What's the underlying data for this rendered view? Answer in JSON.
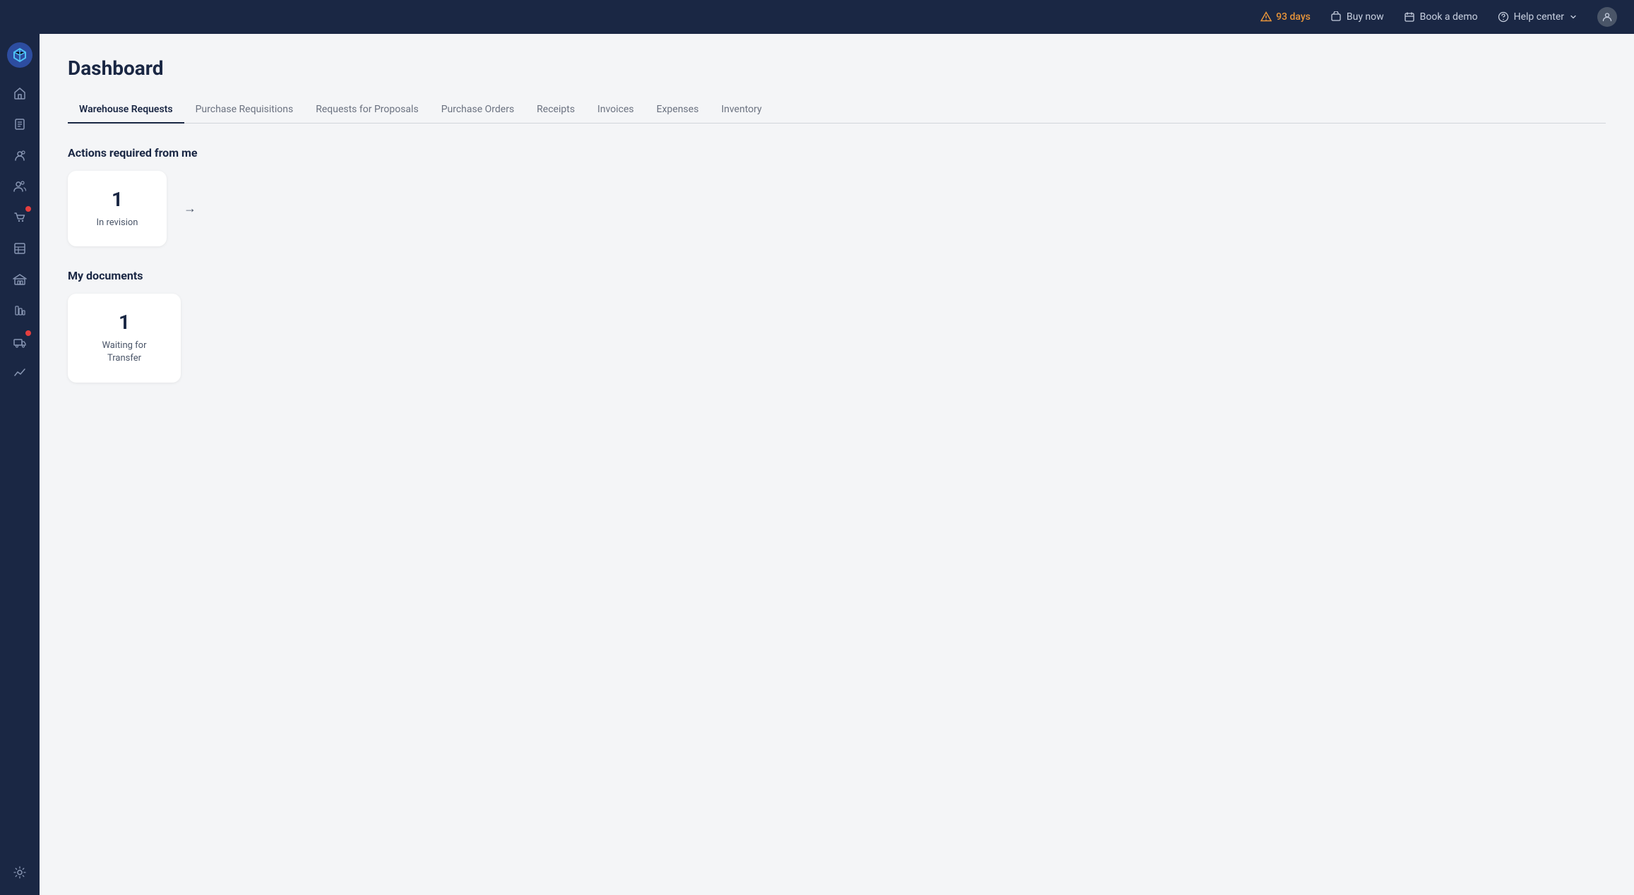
{
  "topbar": {
    "trial_warning": "93 days",
    "buy_now": "Buy now",
    "book_demo": "Book a demo",
    "help_center": "Help center"
  },
  "sidebar": {
    "items": [
      {
        "name": "home",
        "icon": "🏠"
      },
      {
        "name": "orders",
        "icon": "📋"
      },
      {
        "name": "contacts",
        "icon": "👤"
      },
      {
        "name": "users",
        "icon": "👥"
      },
      {
        "name": "purchase",
        "icon": "🛒",
        "badge": true
      },
      {
        "name": "inventory-list",
        "icon": "📦"
      },
      {
        "name": "warehouse",
        "icon": "🏭"
      },
      {
        "name": "reports",
        "icon": "📊"
      },
      {
        "name": "delivery",
        "icon": "🚚",
        "badge": true
      },
      {
        "name": "analytics",
        "icon": "📈"
      },
      {
        "name": "settings",
        "icon": "⚙️"
      }
    ]
  },
  "page": {
    "title": "Dashboard",
    "tabs": [
      {
        "label": "Warehouse Requests",
        "active": true
      },
      {
        "label": "Purchase Requisitions",
        "active": false
      },
      {
        "label": "Requests for Proposals",
        "active": false
      },
      {
        "label": "Purchase Orders",
        "active": false
      },
      {
        "label": "Receipts",
        "active": false
      },
      {
        "label": "Invoices",
        "active": false
      },
      {
        "label": "Expenses",
        "active": false
      },
      {
        "label": "Inventory",
        "active": false
      }
    ],
    "actions_section": {
      "title": "Actions required from me",
      "cards": [
        {
          "number": "1",
          "label": "In revision"
        }
      ]
    },
    "documents_section": {
      "title": "My documents",
      "cards": [
        {
          "number": "1",
          "label": "Waiting for Transfer"
        }
      ]
    }
  }
}
